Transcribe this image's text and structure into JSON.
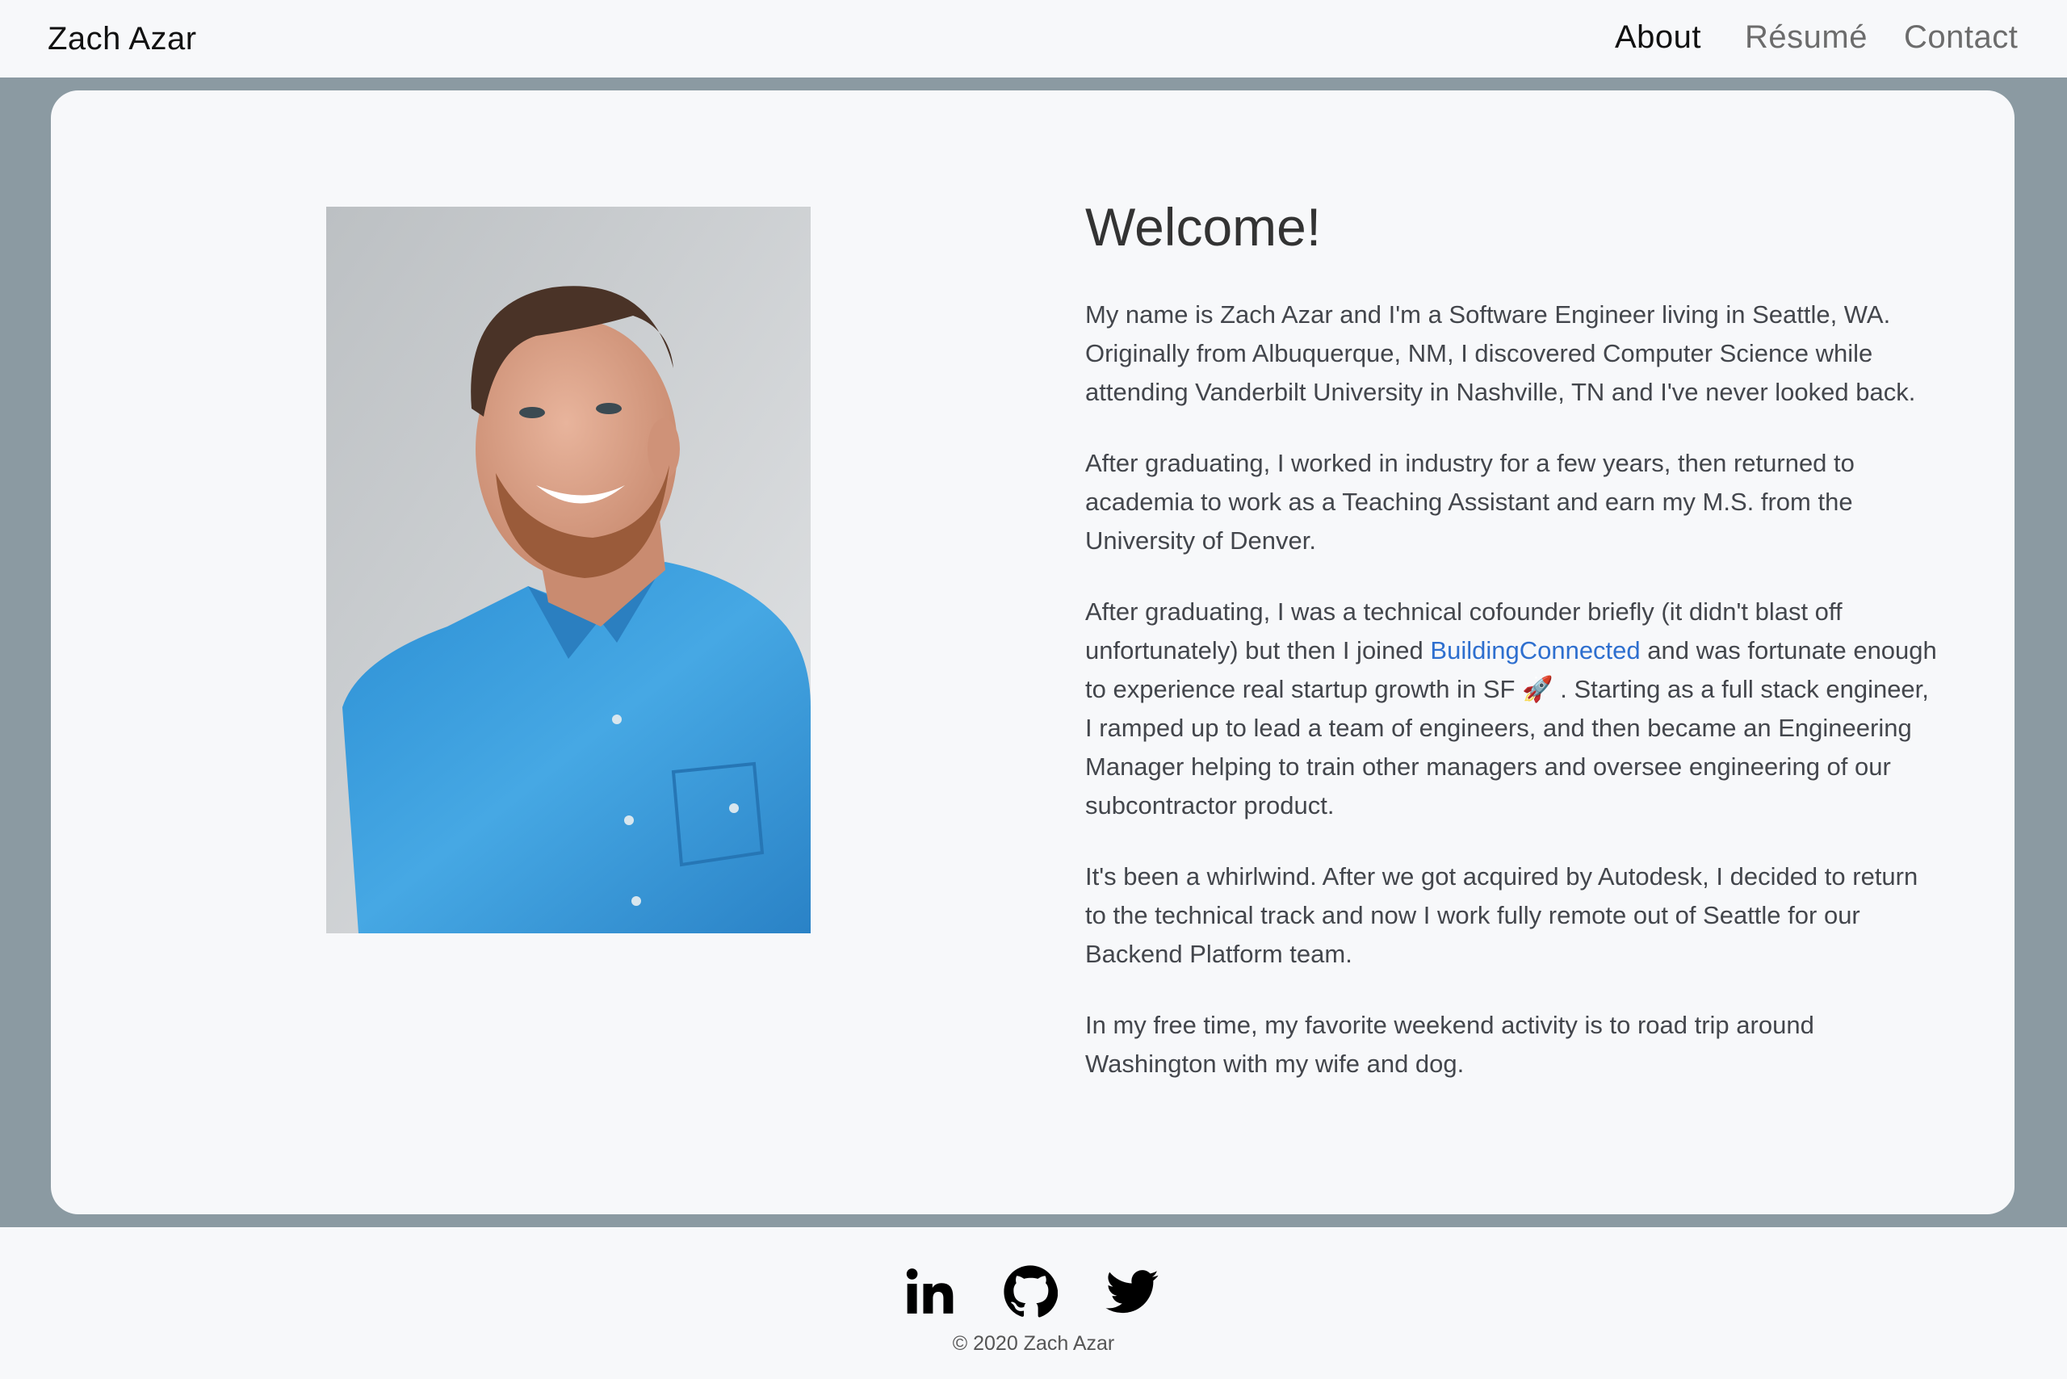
{
  "nav": {
    "brand": "Zach Azar",
    "links": [
      {
        "label": "About",
        "active": true
      },
      {
        "label": "Résumé",
        "active": false
      },
      {
        "label": "Contact",
        "active": false
      }
    ]
  },
  "main": {
    "heading": "Welcome!",
    "paragraphs": {
      "p1": "My name is Zach Azar and I'm a Software Engineer living in Seattle, WA. Originally from Albuquerque, NM, I discovered Computer Science while attending Vanderbilt University in Nashville, TN and I've never looked back.",
      "p2": "After graduating, I worked in industry for a few years, then returned to academia to work as a Teaching Assistant and earn my M.S. from the University of Denver.",
      "p3_before": "After graduating, I was a technical cofounder briefly (it didn't blast off unfortunately) but then I joined ",
      "p3_link": "BuildingConnected",
      "p3_after": " and was fortunate enough to experience real startup growth in SF 🚀 . Starting as a full stack engineer, I ramped up to lead a team of engineers, and then became an Engineering Manager helping to train other managers and oversee engineering of our subcontractor product.",
      "p4": "It's been a whirlwind. After we got acquired by Autodesk, I decided to return to the technical track and now I work fully remote out of Seattle for our Backend Platform team.",
      "p5": "In my free time, my favorite weekend activity is to road trip around Washington with my wife and dog."
    }
  },
  "footer": {
    "social_icons": [
      "linkedin-icon",
      "github-icon",
      "twitter-icon"
    ],
    "copyright": "© 2020 Zach Azar"
  },
  "colors": {
    "background": "#8b9aa2",
    "surface": "#f7f8fa",
    "link": "#2e6fcf",
    "shirt": "#3a9ad8"
  }
}
